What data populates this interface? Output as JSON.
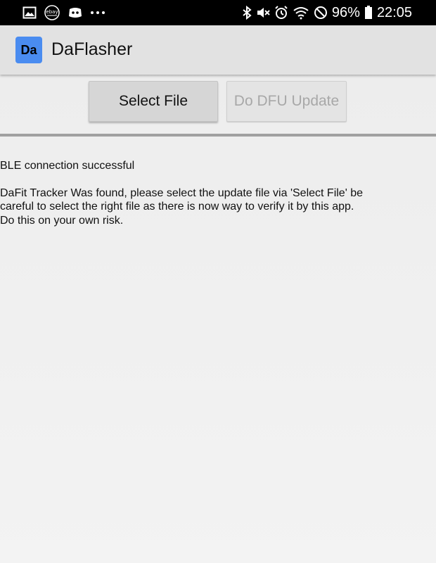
{
  "status_bar": {
    "left_icons": [
      "image-icon",
      "ebay-icon",
      "discord-icon",
      "more-dots-icon"
    ],
    "right_icons": [
      "bluetooth-icon",
      "mute-icon",
      "alarm-icon",
      "wifi-icon",
      "do-not-disturb-icon"
    ],
    "battery": "96%",
    "time": "22:05",
    "ebay_label": "ebay"
  },
  "app_bar": {
    "logo_text": "Da",
    "title": "DaFlasher",
    "logo_color": "#4a8cf0"
  },
  "toolbar": {
    "select_file_label": "Select File",
    "dfu_update_label": "Do DFU Update"
  },
  "log": {
    "line1": "BLE connection successful",
    "line2": "DaFit Tracker Was found, please select the update file via 'Select File' be careful to select the right file as there is now way to verify it by this app. Do this on your own risk."
  }
}
